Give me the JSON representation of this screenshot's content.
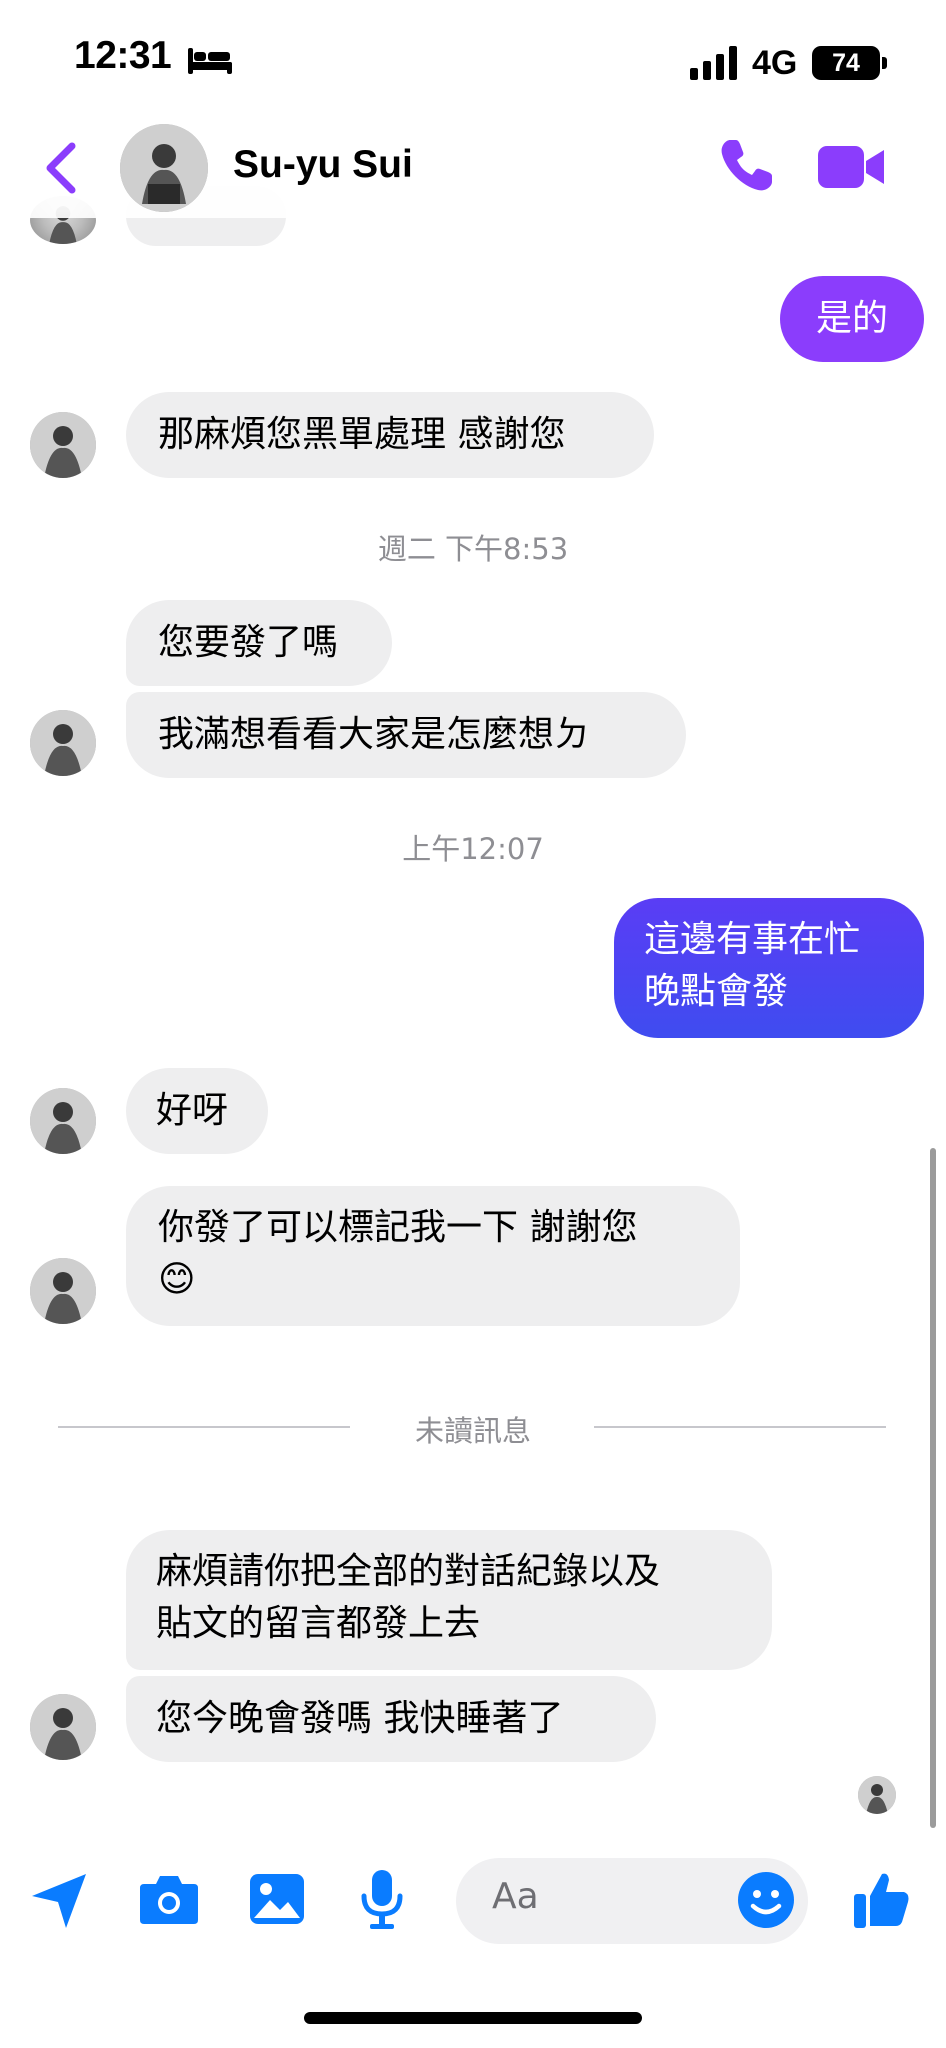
{
  "status_bar": {
    "time": "12:31",
    "network": "4G",
    "battery": "74"
  },
  "header": {
    "contact_name": "Su-yu Sui"
  },
  "colors": {
    "accent": "#8b3dfc",
    "messenger_blue": "#0a7cff",
    "bubble_grey": "#eeeeef"
  },
  "messages": {
    "out_1": "是的",
    "in_1": "那麻煩您黑單處理 感謝您",
    "ts_1": "週二 下午8:53",
    "in_2": "您要發了嗎",
    "in_3": "我滿想看看大家是怎麼想ㄉ",
    "ts_2": "上午12:07",
    "out_2": "這邊有事在忙\n晚點會發",
    "in_4": "好呀",
    "in_5": "你發了可以標記我一下 謝謝您\n😊",
    "unread_divider": "未讀訊息",
    "in_6": "麻煩請你把全部的對話紀錄以及\n貼文的留言都發上去",
    "in_7": "您今晚會發嗎 我快睡著了"
  },
  "composer": {
    "placeholder": "Aa"
  },
  "icons": [
    "bed-icon",
    "signal-icon",
    "back-icon",
    "call-icon",
    "video-icon",
    "send-icon",
    "camera-icon",
    "gallery-icon",
    "mic-icon",
    "emoji-icon",
    "like-icon"
  ]
}
